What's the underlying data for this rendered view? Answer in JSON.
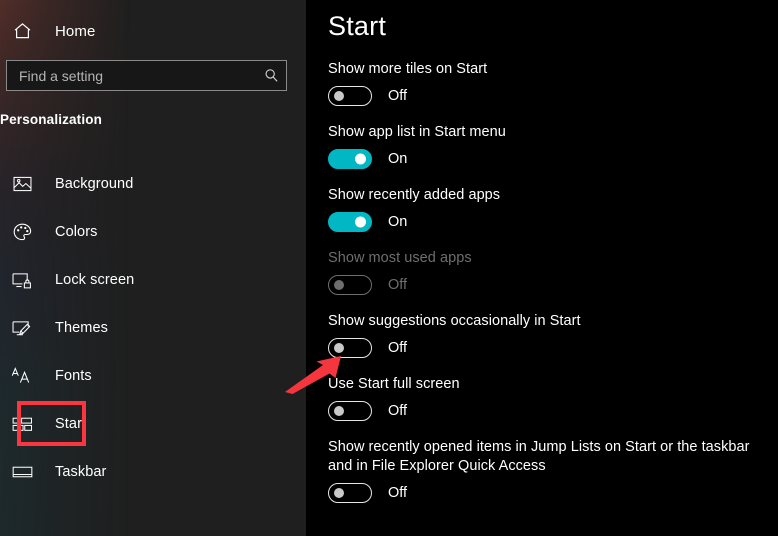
{
  "sidebar": {
    "home": {
      "label": "Home",
      "icon": "home-icon"
    },
    "search": {
      "placeholder": "Find a setting",
      "value": "",
      "icon": "search-icon"
    },
    "category": "Personalization",
    "items": [
      {
        "label": "Background",
        "icon": "picture-icon",
        "selected": false
      },
      {
        "label": "Colors",
        "icon": "palette-icon",
        "selected": false
      },
      {
        "label": "Lock screen",
        "icon": "lock-screen-icon",
        "selected": false
      },
      {
        "label": "Themes",
        "icon": "themes-brush-icon",
        "selected": false
      },
      {
        "label": "Fonts",
        "icon": "fonts-aa-icon",
        "selected": false
      },
      {
        "label": "Start",
        "icon": "start-tiles-icon",
        "selected": true
      },
      {
        "label": "Taskbar",
        "icon": "taskbar-icon",
        "selected": false
      }
    ]
  },
  "main": {
    "title": "Start",
    "settings": [
      {
        "label": "Show more tiles on Start",
        "state": "Off",
        "on": false,
        "disabled": false
      },
      {
        "label": "Show app list in Start menu",
        "state": "On",
        "on": true,
        "disabled": false
      },
      {
        "label": "Show recently added apps",
        "state": "On",
        "on": true,
        "disabled": false
      },
      {
        "label": "Show most used apps",
        "state": "Off",
        "on": false,
        "disabled": true
      },
      {
        "label": "Show suggestions occasionally in Start",
        "state": "Off",
        "on": false,
        "disabled": false
      },
      {
        "label": "Use Start full screen",
        "state": "Off",
        "on": false,
        "disabled": false
      },
      {
        "label": "Show recently opened items in Jump Lists on Start or the taskbar and in File Explorer Quick Access",
        "state": "Off",
        "on": false,
        "disabled": false
      }
    ]
  },
  "annotations": {
    "highlight_color": "#fb3640",
    "arrow_color": "#f6363f",
    "highlighted_nav_item": "Start",
    "arrow_points_to": "Show suggestions occasionally in Start toggle"
  },
  "colors": {
    "accent": "#00b7c3",
    "sidebar_bg": "#1f1f1f",
    "content_bg": "#000000",
    "text": "#ffffff",
    "text_disabled": "#6e6e6e"
  }
}
